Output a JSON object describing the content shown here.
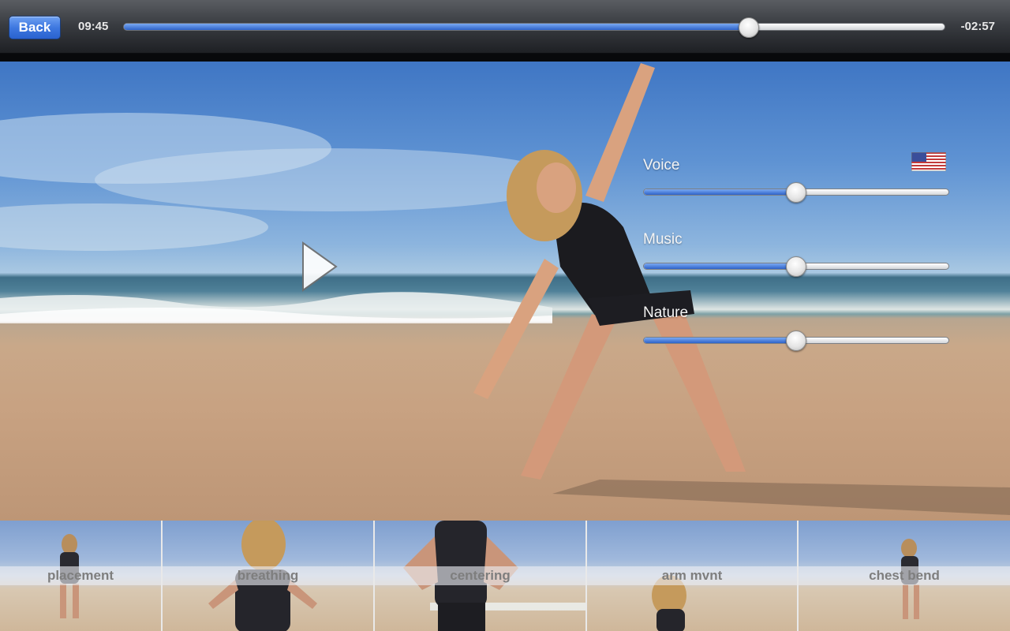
{
  "toolbar": {
    "back_label": "Back",
    "elapsed": "09:45",
    "remaining": "-02:57",
    "progress": 0.762
  },
  "player": {
    "play_icon": "play-icon",
    "language_flag_icon": "us-flag-icon"
  },
  "audio_mix": [
    {
      "label": "Voice",
      "level": 0.5
    },
    {
      "label": "Music",
      "level": 0.5
    },
    {
      "label": "Nature",
      "level": 0.5
    }
  ],
  "chapters": [
    {
      "label": "placement"
    },
    {
      "label": "breathing"
    },
    {
      "label": "centering"
    },
    {
      "label": "arm mvnt"
    },
    {
      "label": "chest bend"
    }
  ],
  "colors": {
    "accent_blue": "#3e78e0",
    "toolbar_dark": "#1e2024"
  }
}
